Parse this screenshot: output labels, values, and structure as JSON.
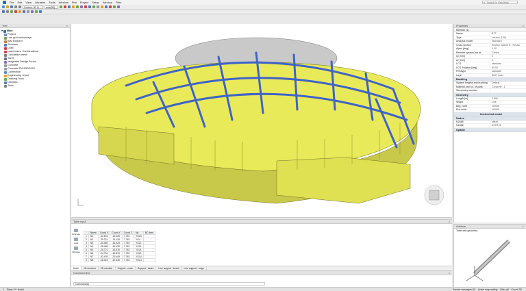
{
  "colors": {
    "accent": "#2a6fb4",
    "structure_yellow": "#e8ea5a",
    "beam_blue": "#3f63c8"
  },
  "menu": [
    "File",
    "Edit",
    "View",
    "Libraries",
    "Tools",
    "Window",
    "Plot",
    "Project",
    "Setup",
    "Window",
    "Files"
  ],
  "search": {
    "placeholder": "Search in Help/Help"
  },
  "toolbar": {
    "view_select": "Context: 3D Vi...",
    "view_select2": "auto(3D)"
  },
  "project_panel": {
    "title": "Tree",
    "root": "Main",
    "items": [
      "Project",
      "Line grid and storeys",
      "BIM Explorer",
      "Structure",
      "Load",
      "Load cases, Combinations",
      "Calculation mesh",
      "Steel",
      "Integrated Design Forms",
      "Concrete",
      "Concrete EN1992/2020",
      "Connection",
      "Engineering report",
      "Drawing Tools",
      "Libraries",
      "Tools"
    ]
  },
  "properties": {
    "title": "Properties",
    "selected": "Member (1)",
    "rows": [
      {
        "k": "Name",
        "v": "B77"
      },
      {
        "k": "Type",
        "v": "column (100)"
      },
      {
        "k": "Analysis model",
        "v": "Standard"
      },
      {
        "k": "Cross section",
        "v": "Section bottom S - Rectar"
      },
      {
        "k": "Alpha [deg]",
        "v": "0.00"
      },
      {
        "k": "Member system-line at",
        "v": "Centre"
      },
      {
        "k": "ey [mm]",
        "v": "0"
      },
      {
        "k": "ez [mm]",
        "v": "0"
      },
      {
        "k": "LCS",
        "v": "standard"
      },
      {
        "k": "LCS Rotation [deg]",
        "v": "90.00"
      },
      {
        "k": "FEMtype",
        "v": "standard"
      },
      {
        "k": "Layer",
        "v": "BGR main"
      }
    ],
    "sections": {
      "buckling": "Buckling",
      "geometry": "Geometry",
      "unchecked": "Unchecked model",
      "nodes": "Nodes",
      "update": "Update"
    },
    "buckling_rows": [
      {
        "k": "System lengths and buckling",
        "v": "Default"
      },
      {
        "k": "Material and no. of parts",
        "v": "Concrete - 1"
      },
      {
        "k": "Secondary member",
        "v": ""
      }
    ],
    "geometry_rows": [
      {
        "k": "Length [m]",
        "v": "3.850"
      },
      {
        "k": "Shape",
        "v": "Line"
      },
      {
        "k": "Beg. node",
        "v": "N2485"
      },
      {
        "k": "End node",
        "v": "N2486"
      }
    ],
    "nodes_rows": [
      {
        "k": "N2485",
        "v": "offset"
      },
      {
        "k": "N2486",
        "v": "ECRT22"
      }
    ]
  },
  "table_panel": {
    "title": "Table input",
    "side_tabs": [
      "Structure",
      "Load",
      "Libraries"
    ],
    "columns": [
      "",
      "Name",
      "Coord X",
      "Coord Y",
      "Coord Z",
      "Nb",
      "BC item"
    ],
    "rows": [
      [
        "1",
        "N1",
        "-33.601",
        "-16.425",
        "7.745",
        "YG25"
      ],
      [
        "2",
        "N2",
        "-35.321",
        "-16.425",
        "7.745",
        "YG4"
      ],
      [
        "3",
        "N3",
        "-30.489",
        "-16.425",
        "7.745",
        "YG21"
      ],
      [
        "4",
        "N4",
        "-28.458",
        "-16.425",
        "7.745",
        "YG21"
      ],
      [
        "5",
        "N5",
        "-26.721",
        "-13.819",
        "7.745",
        "YG21"
      ],
      [
        "6",
        "N6",
        "-24.731",
        "-13.819",
        "7.745",
        "YG21"
      ],
      [
        "7",
        "N7",
        "-63.403",
        "-20.649",
        "7.745",
        "YG14"
      ],
      [
        "8",
        "N8",
        "-28.023",
        "-20.649",
        "7.745",
        "YG14"
      ]
    ],
    "tabs": [
      "Node",
      "1D member",
      "2D member",
      "Support - node",
      "Support - beam",
      "Line support - beam",
      "Line support - edge"
    ]
  },
  "command_panel": {
    "title": "Command line",
    "prompt": "Command(a)"
  },
  "arrow_panel": {
    "title": "Attribute",
    "subtitle": "Table with geometry"
  },
  "status": [
    "1",
    "Plane XY: Nodal",
    "Service messages (0)",
    "Active snap setting",
    "Filter off",
    "Coord: 3D"
  ]
}
